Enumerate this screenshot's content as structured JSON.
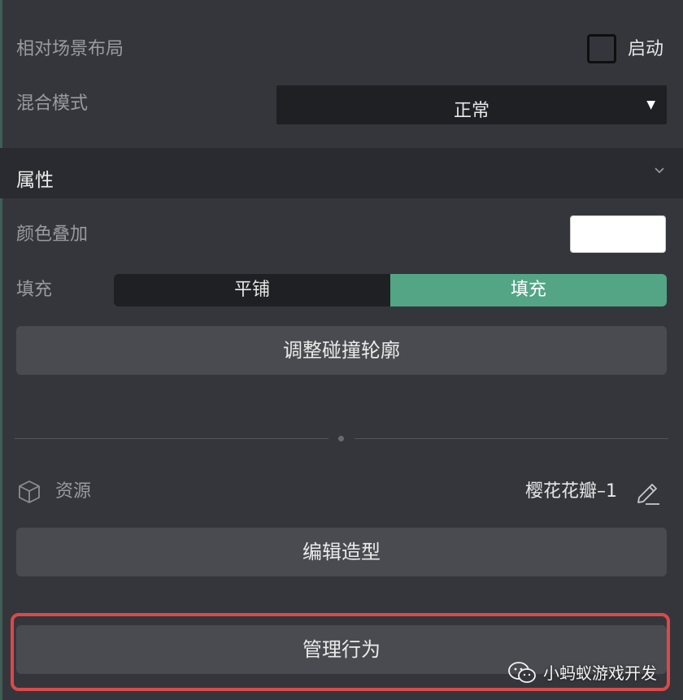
{
  "layout_settings": {
    "relative_layout_label": "相对场景布局",
    "enable_label": "启动",
    "blend_mode_label": "混合模式",
    "blend_mode_value": "正常"
  },
  "properties": {
    "section_title": "属性",
    "color_overlay_label": "颜色叠加",
    "color_overlay_value": "#ffffff",
    "fill_label": "填充",
    "fill_options": [
      "平铺",
      "填充"
    ],
    "fill_selected": "填充",
    "adjust_collision_button": "调整碰撞轮廓"
  },
  "resource": {
    "label": "资源",
    "name": "樱花花瓣–1",
    "edit_shape_button": "编辑造型"
  },
  "manage_behavior_button": "管理行为",
  "watermark": "小蚂蚁游戏开发",
  "colors": {
    "panel_bg": "#35363c",
    "accent_green": "#53a585",
    "highlight_red": "#d94a4a"
  }
}
